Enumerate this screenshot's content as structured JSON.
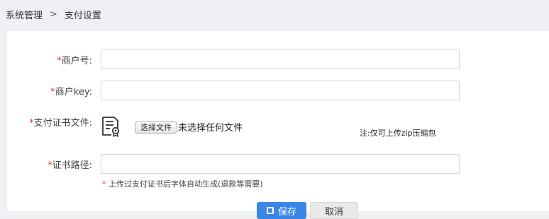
{
  "breadcrumb": {
    "parent": "系统管理",
    "separator": ">",
    "current": "支付设置"
  },
  "form": {
    "required_mark": "*",
    "merchant_id": {
      "label": "商户号:",
      "value": ""
    },
    "merchant_key": {
      "label": "商户key:",
      "value": ""
    },
    "cert_file": {
      "label": "支付证书文件:",
      "icon": "certificate-file-icon",
      "button": "选择文件",
      "status": "未选择任何文件",
      "note": "注:仅可上传zip压缩包"
    },
    "cert_path": {
      "label": "证书路径:",
      "value": "",
      "hint": "上传过支付证书后字体自动生成(退款等需要)"
    }
  },
  "actions": {
    "save": "保存",
    "cancel": "取消"
  },
  "colors": {
    "primary": "#3a86e8",
    "required": "#ee3333",
    "background": "#eef0f4"
  }
}
